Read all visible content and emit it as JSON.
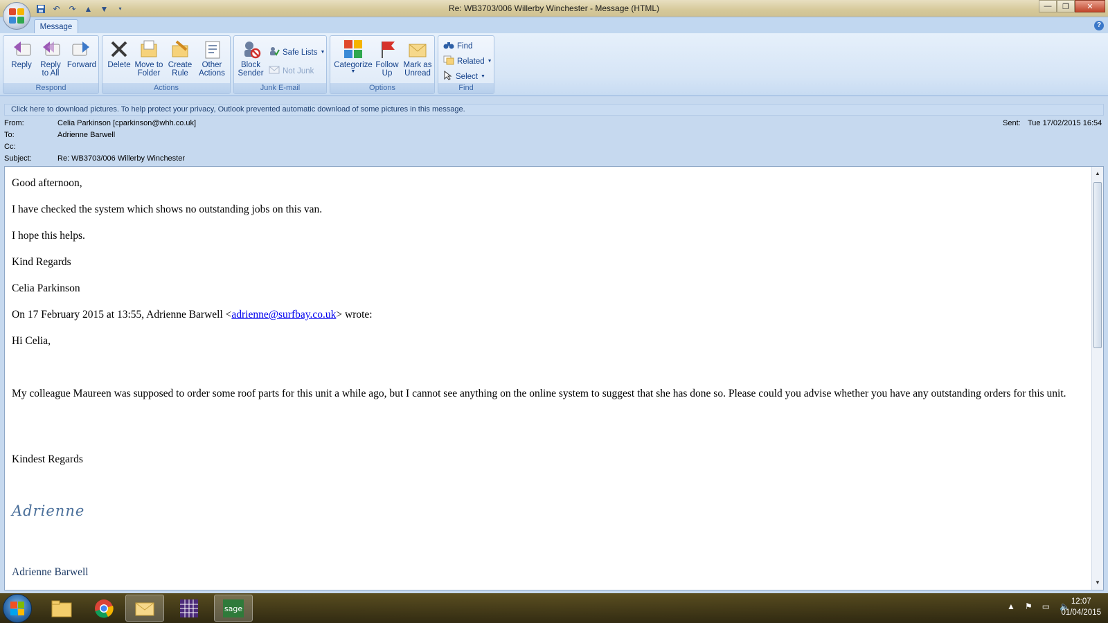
{
  "window": {
    "title": "Re: WB3703/006 Willerby Winchester - Message (HTML)",
    "minimize": "—",
    "restore": "❐",
    "close": "✕"
  },
  "tabs": {
    "message": "Message"
  },
  "ribbon": {
    "respond": {
      "label": "Respond",
      "reply": "Reply",
      "reply_all": "Reply\nto All",
      "forward": "Forward"
    },
    "actions": {
      "label": "Actions",
      "delete": "Delete",
      "move_to_folder": "Move to\nFolder",
      "create_rule": "Create\nRule",
      "other_actions": "Other\nActions"
    },
    "junk": {
      "label": "Junk E-mail",
      "block_sender": "Block\nSender",
      "safe_lists": "Safe Lists",
      "not_junk": "Not Junk"
    },
    "options": {
      "label": "Options",
      "categorize": "Categorize",
      "follow_up": "Follow\nUp",
      "mark_unread": "Mark as\nUnread"
    },
    "find": {
      "label": "Find",
      "find": "Find",
      "related": "Related",
      "select": "Select"
    }
  },
  "infobar": "Click here to download pictures. To help protect your privacy, Outlook prevented automatic download of some pictures in this message.",
  "header": {
    "from_label": "From:",
    "from": "Celia Parkinson [cparkinson@whh.co.uk]",
    "to_label": "To:",
    "to": "Adrienne Barwell",
    "cc_label": "Cc:",
    "cc": "",
    "subject_label": "Subject:",
    "subject": "Re: WB3703/006 Willerby Winchester",
    "sent_label": "Sent:",
    "sent": "Tue 17/02/2015 16:54"
  },
  "body": {
    "greeting": "Good afternoon,",
    "line1": "I have checked the system which shows no outstanding jobs on this van.",
    "line2": "I hope this helps.",
    "regards": "Kind Regards",
    "sender": "Celia Parkinson",
    "quote_intro_prefix": "On 17 February 2015 at 13:55, Adrienne Barwell <",
    "quote_email": "adrienne@surfbay.co.uk",
    "quote_intro_suffix": "> wrote:",
    "hi": "Hi Celia,",
    "paragraph": "My colleague Maureen was supposed to order some roof parts for this unit a while ago, but I cannot see anything on the online system to suggest that she has done so.  Please could you advise whether you have any outstanding orders for this unit.",
    "kindest": "Kindest Regards",
    "signature_script": "Adrienne",
    "signature_name": "Adrienne Barwell"
  },
  "taskbar": {
    "time": "12:07",
    "date": "01/04/2015"
  },
  "colors": {
    "accent": "#15428b",
    "ribbon_bg": "#dde9f7",
    "link": "#0000ee"
  }
}
